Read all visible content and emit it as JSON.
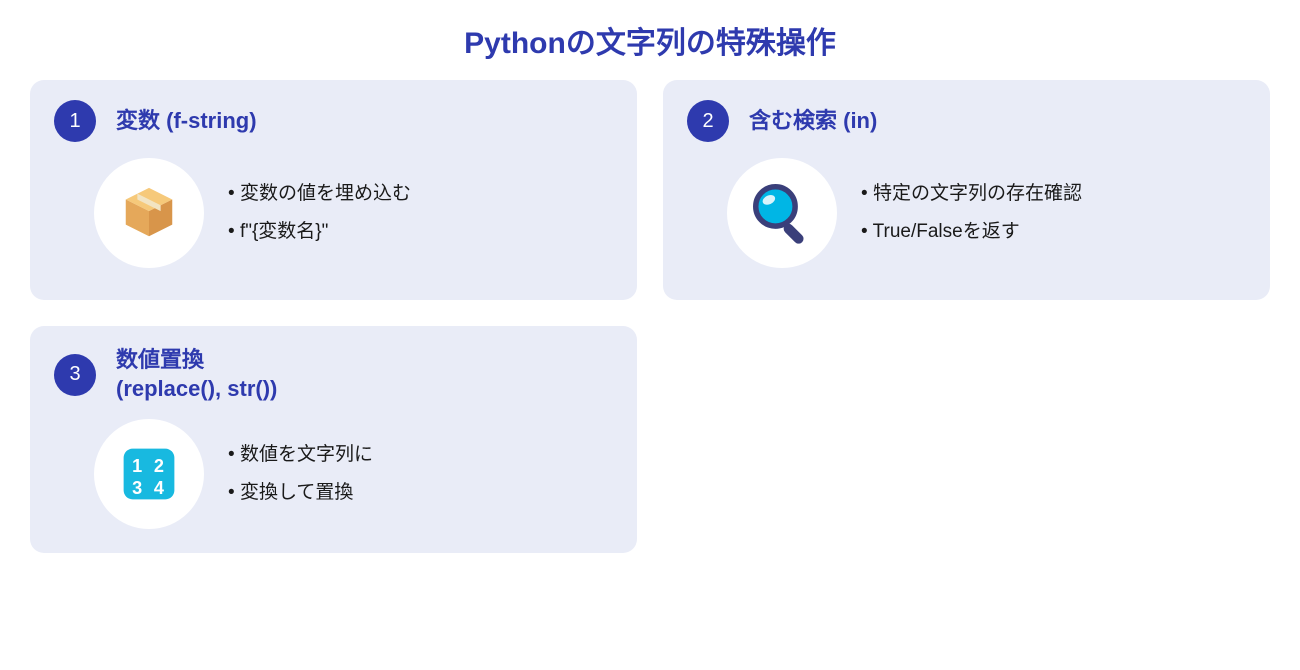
{
  "title": "Pythonの文字列の特殊操作",
  "cards": [
    {
      "num": "1",
      "title": "変数 (f-string)",
      "bullets": [
        "変数の値を埋め込む",
        "f\"{変数名}\""
      ],
      "icon": "box"
    },
    {
      "num": "2",
      "title": "含む検索 (in)",
      "bullets": [
        "特定の文字列の存在確認",
        "True/Falseを返す"
      ],
      "icon": "magnifier"
    },
    {
      "num": "3",
      "title": "数値置換\n(replace(), str())",
      "bullets": [
        "数値を文字列に",
        "変換して置換"
      ],
      "icon": "numbers"
    }
  ]
}
